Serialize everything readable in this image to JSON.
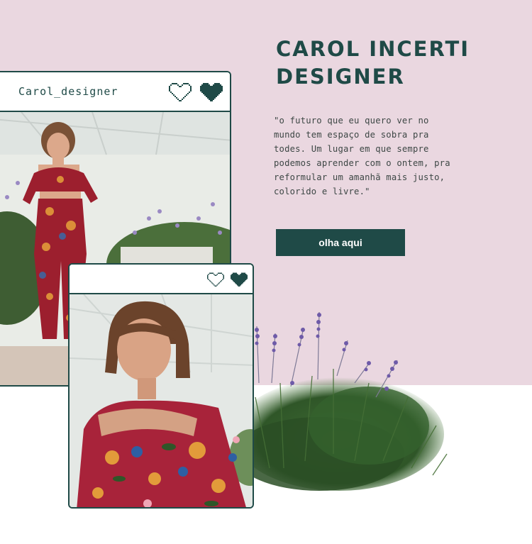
{
  "hero": {
    "title_line1": "CAROL INCERTI",
    "title_line2": "DESIGNER",
    "quote_lines": [
      "\"o futuro que eu quero ver no",
      "mundo tem espaço de sobra pra",
      "todes. Um lugar em que sempre",
      "podemos aprender com o ontem, pra",
      "reformular um amanhã mais justo,",
      "colorido e livre.\""
    ],
    "cta_label": "olha aqui"
  },
  "posts": [
    {
      "username": "Carol_designer",
      "icons": [
        "heart-outline-icon",
        "heart-filled-icon"
      ]
    },
    {
      "username": "",
      "icons": [
        "heart-outline-icon",
        "heart-filled-icon"
      ]
    }
  ],
  "colors": {
    "accent": "#1f4a47",
    "pink_background": "#ead7e0",
    "text": "#3d4745"
  }
}
